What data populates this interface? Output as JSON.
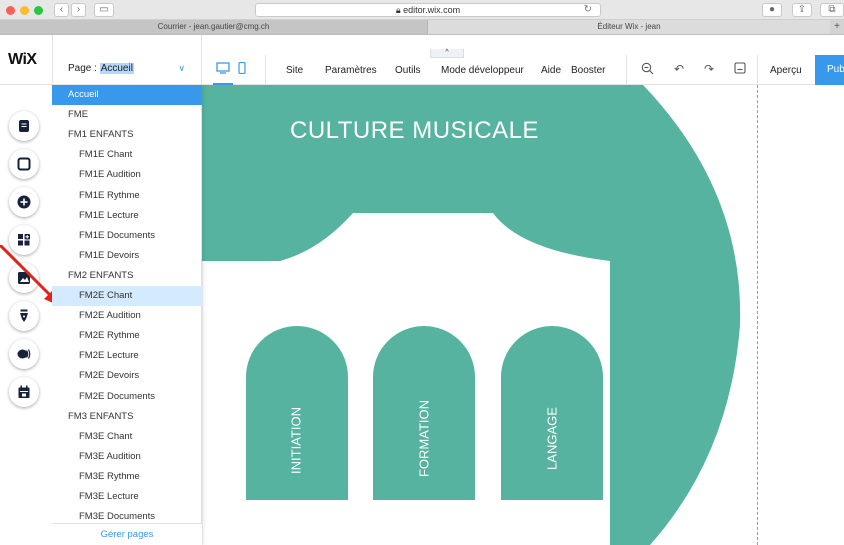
{
  "browser": {
    "url": "editor.wix.com",
    "tabs": [
      "Courrier - jean.gautier@cmg.ch",
      "Éditeur Wix - jean"
    ]
  },
  "wix": {
    "logo": "WiX",
    "page_label": "Page :",
    "current_page": "Accueil",
    "menu": [
      "Site",
      "Paramètres",
      "Outils",
      "Mode développeur",
      "Aide",
      "Booster"
    ],
    "preview": "Aperçu",
    "publish": "Publier",
    "accent": "#3899ec"
  },
  "page_list": {
    "items": [
      {
        "label": "Accueil",
        "level": 0,
        "state": "active"
      },
      {
        "label": "FME",
        "level": 0
      },
      {
        "label": "FM1 ENFANTS",
        "level": 0
      },
      {
        "label": "FM1E Chant",
        "level": 1
      },
      {
        "label": "FM1E Audition",
        "level": 1
      },
      {
        "label": "FM1E Rythme",
        "level": 1
      },
      {
        "label": "FM1E Lecture",
        "level": 1
      },
      {
        "label": "FM1E Documents",
        "level": 1
      },
      {
        "label": "FM1E Devoirs",
        "level": 1
      },
      {
        "label": "FM2 ENFANTS",
        "level": 0
      },
      {
        "label": "FM2E Chant",
        "level": 1,
        "state": "hover"
      },
      {
        "label": "FM2E Audition",
        "level": 1
      },
      {
        "label": "FM2E Rythme",
        "level": 1
      },
      {
        "label": "FM2E Lecture",
        "level": 1
      },
      {
        "label": "FM2E Devoirs",
        "level": 1
      },
      {
        "label": "FM2E Documents",
        "level": 1
      },
      {
        "label": "FM3 ENFANTS",
        "level": 0
      },
      {
        "label": "FM3E Chant",
        "level": 1
      },
      {
        "label": "FM3E Audition",
        "level": 1
      },
      {
        "label": "FM3E Rythme",
        "level": 1
      },
      {
        "label": "FM3E Lecture",
        "level": 1
      },
      {
        "label": "FM3E Documents",
        "level": 1
      }
    ],
    "footer": "Gérer pages"
  },
  "canvas": {
    "title": "CULTURE MUSICALE",
    "arches": [
      "INITIATION",
      "FORMATION",
      "LANGAGE"
    ],
    "teal": "#55b3a0"
  },
  "tools": [
    "pages-icon",
    "background-icon",
    "add-icon",
    "apps-icon",
    "media-icon",
    "pen-icon",
    "chat-icon",
    "calendar-icon"
  ]
}
